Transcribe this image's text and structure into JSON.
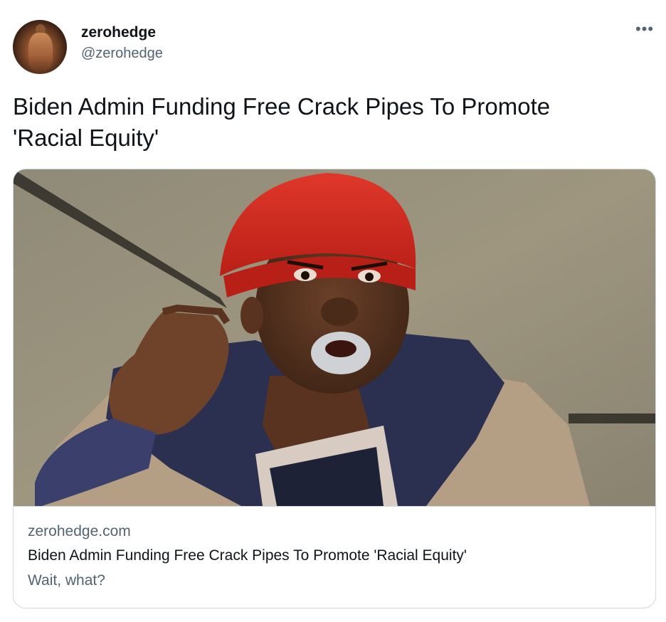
{
  "tweet": {
    "display_name": "zerohedge",
    "handle": "@zerohedge",
    "more_label": "•••",
    "text_line1": "Biden Admin Funding Free Crack Pipes To Promote",
    "text_line2": "'Racial Equity'"
  },
  "card": {
    "domain": "zerohedge.com",
    "title": "Biden Admin Funding Free Crack Pipes To Promote 'Racial Equity'",
    "description": "Wait, what?"
  },
  "colors": {
    "text": "#0f1419",
    "muted": "#536471",
    "border": "#cfd9de",
    "hat_red": "#d62a1e"
  },
  "icons": {
    "more": "ellipsis-icon"
  }
}
